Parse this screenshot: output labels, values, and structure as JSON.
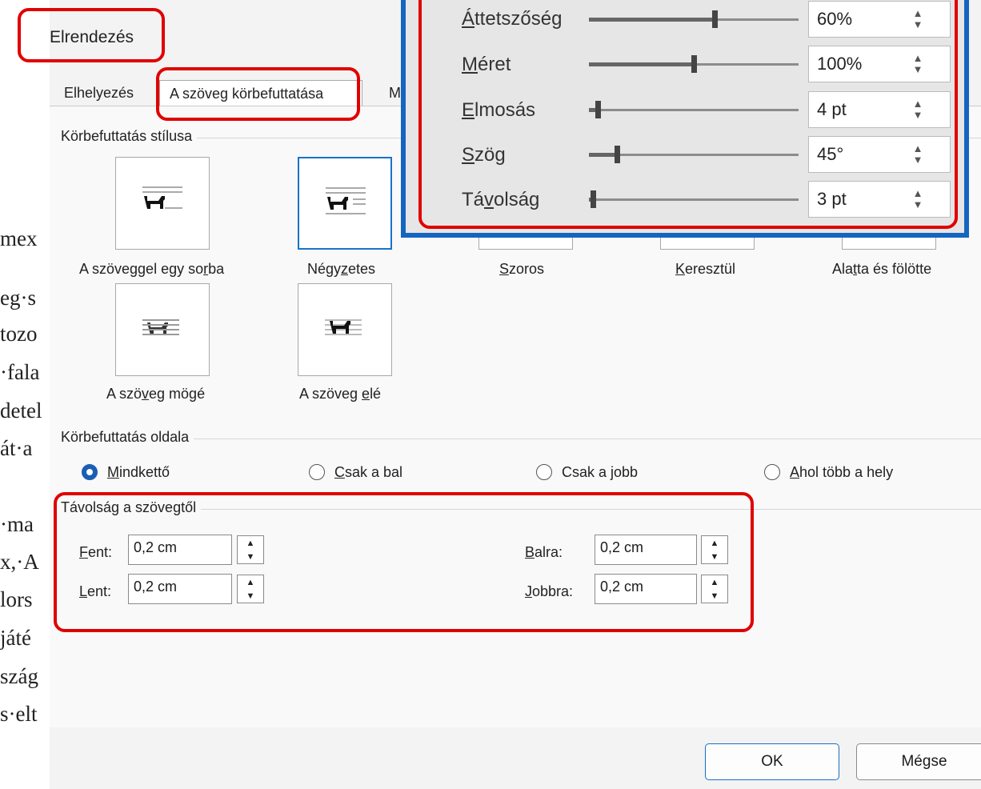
{
  "document_background": {
    "lines": [
      "mex",
      "eg·s",
      "tozo",
      "·fala",
      "detel",
      "át·a",
      "·ma",
      "x,·A",
      "lors",
      "játé",
      "szág",
      "s·elt"
    ]
  },
  "dialog": {
    "title": "Elrendezés",
    "tabs": [
      {
        "label": "Elhelyezés"
      },
      {
        "label": "A szöveg körbefuttatása"
      },
      {
        "label": "M"
      }
    ],
    "wrap_style": {
      "title": "Körbefuttatás stílusa",
      "options": [
        {
          "label_pre": "A szöveggel egy so",
          "label_u": "r",
          "label_post": "ba",
          "icon": "dog-inline-icon"
        },
        {
          "label_pre": "Négy",
          "label_u": "z",
          "label_post": "etes",
          "icon": "dog-square-icon"
        },
        {
          "label_pre": "",
          "label_u": "S",
          "label_post": "zoros",
          "icon": "dog-tight-icon"
        },
        {
          "label_pre": "",
          "label_u": "K",
          "label_post": "eresztül",
          "icon": "dog-through-icon"
        },
        {
          "label_pre": "Ala",
          "label_u": "t",
          "label_post": "ta és fölötte",
          "icon": "dog-topbottom-icon"
        },
        {
          "label_pre": "A szö",
          "label_u": "v",
          "label_post": "eg mögé",
          "icon": "dog-behind-icon"
        },
        {
          "label_pre": "A szöveg ",
          "label_u": "e",
          "label_post": "lé",
          "icon": "dog-front-icon"
        }
      ],
      "selected": "Négyzetes"
    },
    "wrap_side": {
      "title": "Körbefuttatás oldala",
      "options": [
        {
          "label_u": "M",
          "label_post": "indkettő",
          "checked": true
        },
        {
          "label_u": "C",
          "label_post": "sak a bal",
          "checked": false
        },
        {
          "label_pre": "Csak a ",
          "label_u": "j",
          "label_post": "obb",
          "checked": false
        },
        {
          "label_u": "A",
          "label_post": "hol több a hely",
          "checked": false
        }
      ]
    },
    "distance": {
      "title": "Távolság a szövegtől",
      "top": {
        "label_u": "F",
        "label_post": "ent:",
        "value": "0,2 cm"
      },
      "bottom": {
        "label_u": "L",
        "label_post": "ent:",
        "value": "0,2 cm"
      },
      "left": {
        "label_u": "B",
        "label_post": "alra:",
        "value": "0,2 cm"
      },
      "right": {
        "label_u": "J",
        "label_post": "obbra:",
        "value": "0,2 cm"
      }
    },
    "buttons": {
      "ok": "OK",
      "cancel": "Mégse"
    }
  },
  "shadow_panel": {
    "rows": [
      {
        "label_u": "Á",
        "label_post": "ttetszőség",
        "value": "60%",
        "level": 0.6
      },
      {
        "label_u": "M",
        "label_post": "éret",
        "value": "100%",
        "level": 0.5
      },
      {
        "label_u": "E",
        "label_post": "lmosás",
        "value": "4 pt",
        "level": 0.04
      },
      {
        "label_u": "S",
        "label_post": "zög",
        "value": "45°",
        "level": 0.13
      },
      {
        "label_pre": "Tá",
        "label_u": "v",
        "label_post": "olság",
        "value": "3 pt",
        "level": 0.02
      }
    ]
  },
  "colors": {
    "accent": "#1a5fb4",
    "highlight_red": "#e00000",
    "overlay_border": "#1565c0"
  }
}
